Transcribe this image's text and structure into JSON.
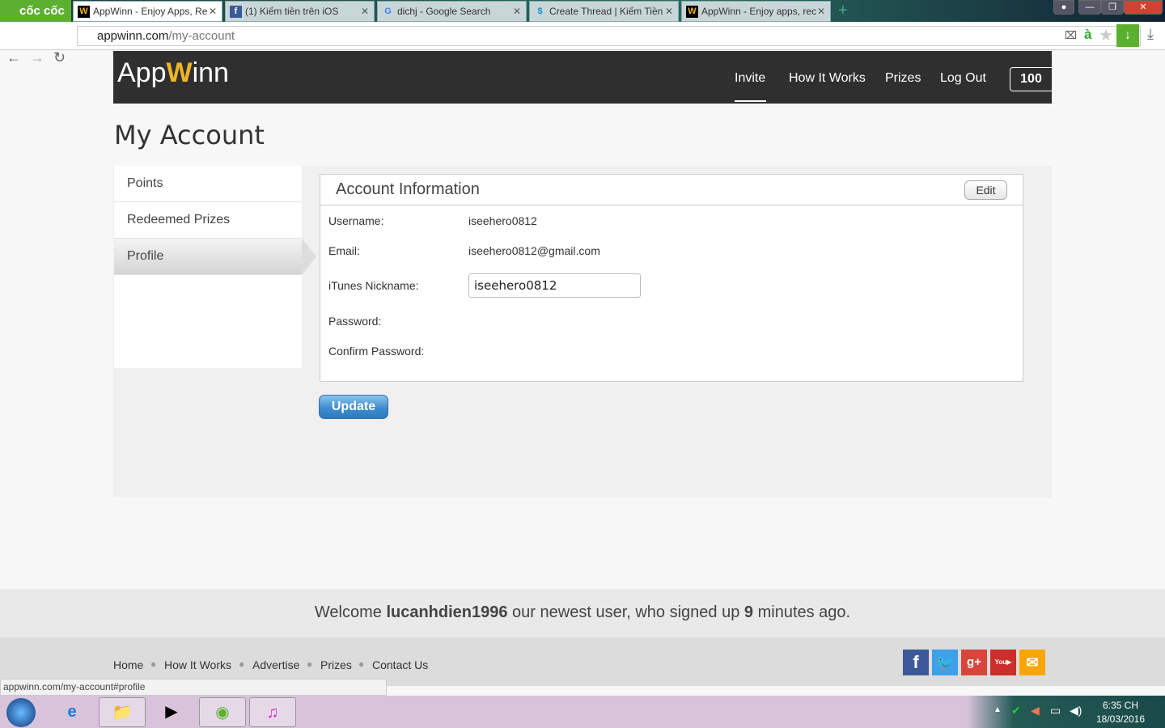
{
  "browser": {
    "brand": "cốc cốc",
    "tabs": [
      {
        "title": "AppWinn - Enjoy Apps, Re",
        "active": true
      },
      {
        "title": "(1) Kiếm tiền trên iOS"
      },
      {
        "title": "dichj - Google Search"
      },
      {
        "title": "Create Thread | Kiếm Tiền"
      },
      {
        "title": "AppWinn - Enjoy apps, rec"
      }
    ],
    "url_host": "appwinn.com",
    "url_path": "/my-account",
    "status_url": "appwinn.com/my-account#profile"
  },
  "site": {
    "logo_a": "App",
    "logo_w": "W",
    "logo_b": "inn",
    "nav": [
      "Invite",
      "How It Works",
      "Prizes",
      "Log Out"
    ],
    "points": "100"
  },
  "page": {
    "title": "My Account",
    "sidebar": [
      "Points",
      "Redeemed Prizes",
      "Profile"
    ],
    "account": {
      "heading": "Account Information",
      "edit": "Edit",
      "username_label": "Username:",
      "username": "iseehero0812",
      "email_label": "Email:",
      "email": "iseehero0812@gmail.com",
      "nickname_label": "iTunes Nickname:",
      "nickname": "iseehero0812",
      "password_label": "Password:",
      "confirm_label": "Confirm Password:"
    },
    "update": "Update"
  },
  "welcome": {
    "pre": "Welcome ",
    "user": "lucanhdien1996",
    "mid": " our newest user, who signed up ",
    "num": "9",
    "post": " minutes ago."
  },
  "footer": {
    "links": [
      "Home",
      "How It Works",
      "Advertise",
      "Prizes",
      "Contact Us"
    ]
  },
  "colors": {
    "header": "#2f2f2f",
    "accent": "#f0b429",
    "button": "#3d8dd0"
  },
  "taskbar": {
    "time": "6:35 CH",
    "date": "18/03/2016"
  }
}
